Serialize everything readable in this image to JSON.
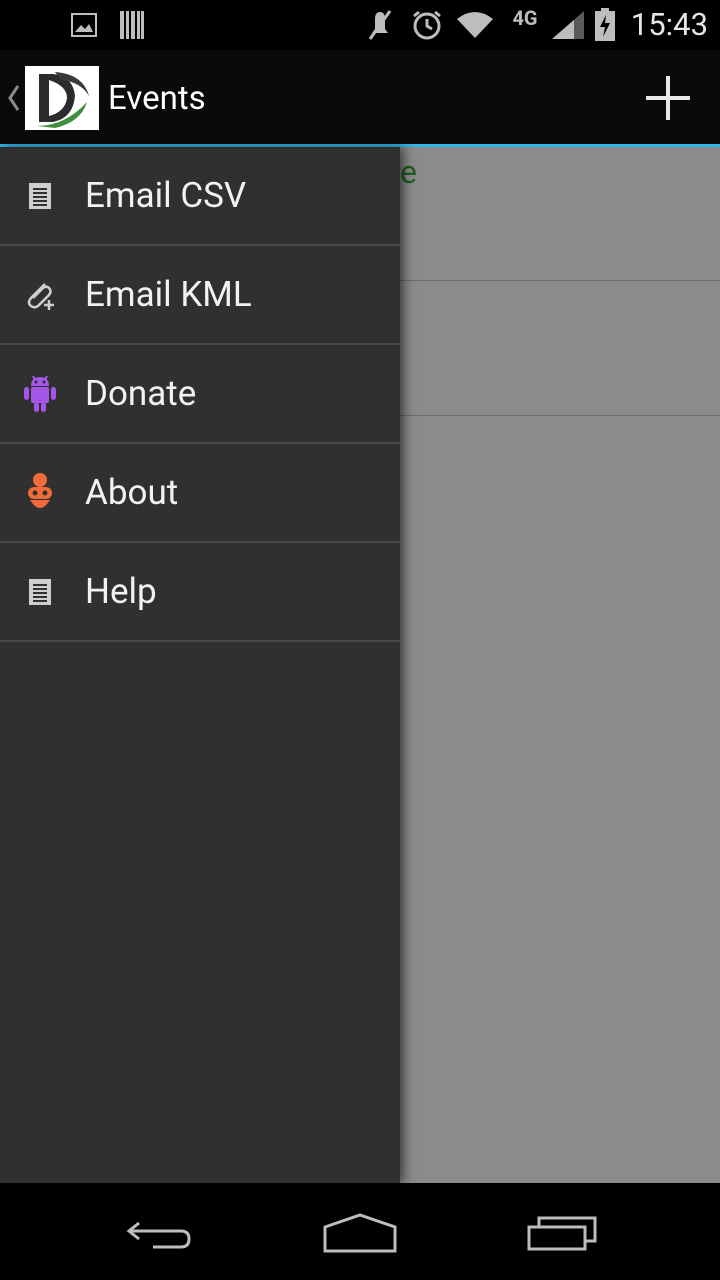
{
  "status_bar": {
    "time": "15:43",
    "network_label": "4G",
    "icons": [
      "image-icon",
      "barcode-icon",
      "mute-icon",
      "alarm-icon",
      "wifi-icon",
      "lte-signal-icon",
      "battery-charging-icon"
    ]
  },
  "action_bar": {
    "title": "Events",
    "up_icon": "chevron-left-icon",
    "logo_icon": "app-logo",
    "add_icon": "plus-icon"
  },
  "content": {
    "peek_text": "e"
  },
  "drawer": {
    "items": [
      {
        "label": "Email CSV",
        "icon": "document-icon"
      },
      {
        "label": "Email KML",
        "icon": "attachment-icon"
      },
      {
        "label": "Donate",
        "icon": "android-icon"
      },
      {
        "label": "About",
        "icon": "robot-icon"
      },
      {
        "label": "Help",
        "icon": "document-icon"
      }
    ]
  },
  "nav_bar": {
    "back_icon": "back-icon",
    "home_icon": "home-icon",
    "recents_icon": "recents-icon"
  },
  "colors": {
    "accent": "#33b5e5",
    "drawer_bg": "#303030",
    "content_bg": "#8b8b8b",
    "donate_icon": "#a356e8",
    "about_icon": "#f26b3a"
  }
}
